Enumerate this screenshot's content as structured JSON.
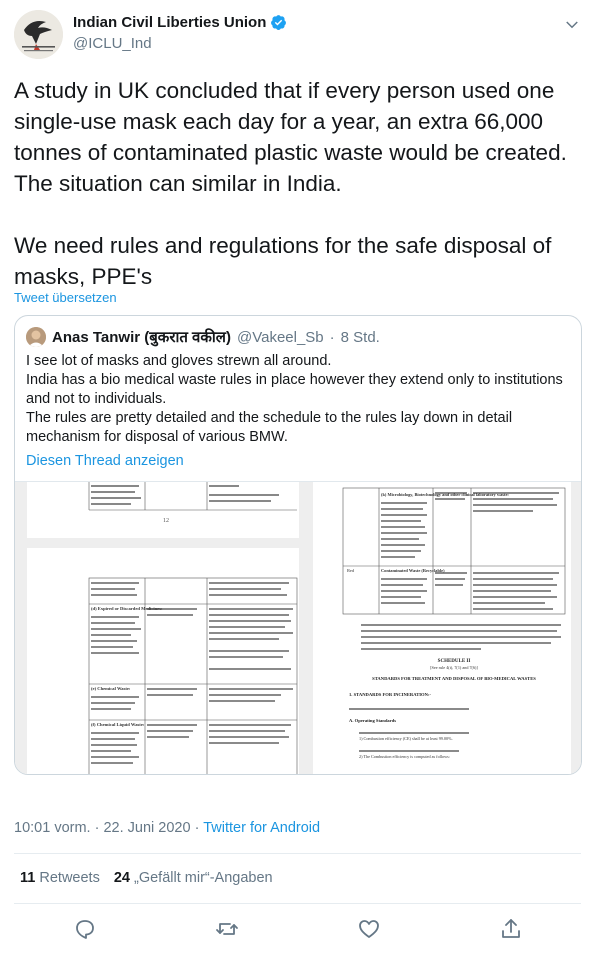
{
  "author": {
    "display_name": "Indian Civil Liberties Union",
    "handle": "@ICLU_Ind",
    "avatar_text": "INDIAN CIVIL LIBERTIES UNION"
  },
  "tweet": {
    "text": "A study in UK concluded that if every person used one single-use mask each day for a year, an extra 66,000 tonnes of contaminated plastic waste would be created. The situation can similar in India.\n\nWe need rules and regulations for the safe disposal of masks, PPE's",
    "translate_label": "Tweet übersetzen"
  },
  "quoted": {
    "display_name": "Anas Tanwir (बुकरात वकील)",
    "handle": "@Vakeel_Sb",
    "separator": "·",
    "time": "8 Std.",
    "text": "I see lot of masks and gloves strewn all around.\nIndia has a bio medical waste rules in place however they extend only to institutions and not to individuals.\nThe rules are pretty detailed and the schedule to the rules lay down in detail mechanism for disposal of various BMW.",
    "thread_link": "Diesen Thread anzeigen"
  },
  "media": {
    "left_doc": {
      "page_number": "12",
      "row1": "(d) Expired or Discarded Medicines:",
      "row2": "(e) Chemical Waste:",
      "row3": "(f) Chemical Liquid Waste:"
    },
    "right_doc": {
      "row1": "(k) Microbiology, Biotechnology and other clinical laboratory waste:",
      "row2": "Red",
      "row3": "Contaminated Waste (Recyclable)",
      "schedule_title": "SCHEDULE II",
      "schedule_sub": "[See rule 4(t), 7(1) and 7(6)]",
      "standards_title": "STANDARDS FOR TREATMENT AND DISPOSAL OF BIO-MEDICAL WASTES",
      "section1": "1.   STANDARDS FOR INCINERATION:-",
      "section_a": "A.   Operating Standards",
      "line1": "1)  Combustion efficiency (CE) shall be at least 99.00%.",
      "line2": "2)  The Combustion efficiency is computed as follows:"
    }
  },
  "meta": {
    "time": "10:01 vorm.",
    "separator": "·",
    "date": "22. Juni 2020",
    "source": "Twitter for Android"
  },
  "stats": {
    "retweets_count": "11",
    "retweets_label": "Retweets",
    "likes_count": "24",
    "likes_label": "„Gefällt mir“-Angaben"
  },
  "colors": {
    "link": "#1b95e0",
    "secondary": "#657786",
    "border": "#ccd6dd",
    "verified": "#1da1f2"
  },
  "icons": [
    "verified-badge-icon",
    "chevron-down-icon",
    "reply-icon",
    "retweet-icon",
    "like-icon",
    "share-icon"
  ]
}
